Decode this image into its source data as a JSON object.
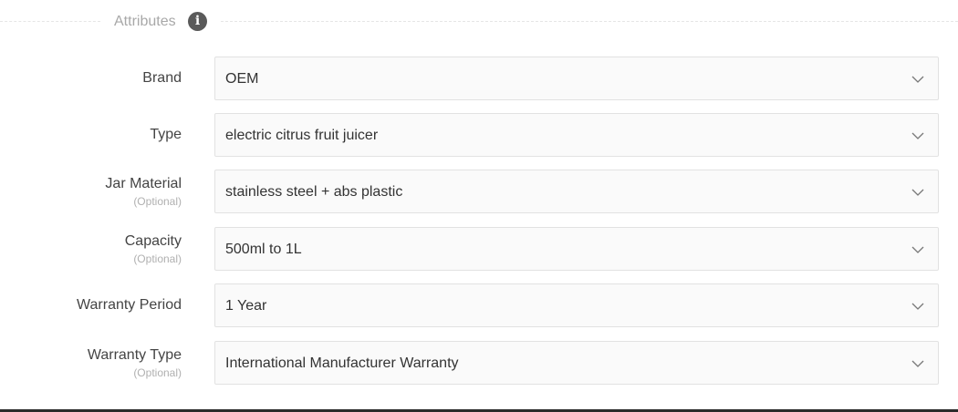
{
  "section": {
    "title": "Attributes",
    "info_icon": "info-icon"
  },
  "optional_text": "(Optional)",
  "fields": [
    {
      "label": "Brand",
      "optional": "",
      "value": "OEM"
    },
    {
      "label": "Type",
      "optional": "",
      "value": "electric citrus fruit juicer"
    },
    {
      "label": "Jar Material",
      "optional": "(Optional)",
      "value": "stainless steel + abs plastic"
    },
    {
      "label": "Capacity",
      "optional": "(Optional)",
      "value": "500ml to 1L"
    },
    {
      "label": "Warranty Period",
      "optional": "",
      "value": "1 Year"
    },
    {
      "label": "Warranty Type",
      "optional": "(Optional)",
      "value": "International Manufacturer Warranty"
    }
  ],
  "icons": {
    "dropdown": "chevron-down-icon"
  }
}
